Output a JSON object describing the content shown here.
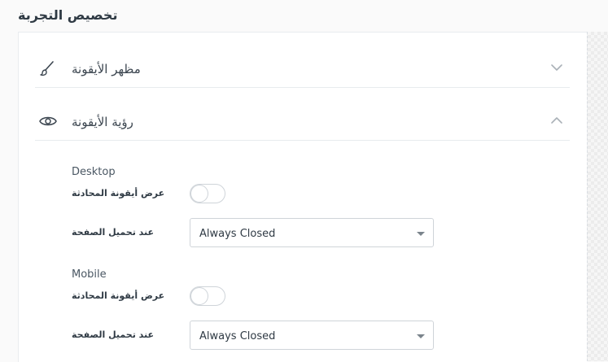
{
  "page": {
    "title": "تخصيص التجربة"
  },
  "sections": [
    {
      "label": "مظهر الأيقونة",
      "icon": "brush-icon",
      "expanded": false
    },
    {
      "label": "رؤية الأيقونة",
      "icon": "eye-icon",
      "expanded": true
    }
  ],
  "desktop": {
    "label": "Desktop",
    "show_icon_label": "عرض أيقونة المحادثة",
    "show_icon_enabled": false,
    "on_load_label": "عند تحميل الصفحة",
    "on_load_value": "Always Closed"
  },
  "mobile": {
    "label": "Mobile",
    "show_icon_label": "عرض أيقونة المحادثة",
    "show_icon_enabled": false,
    "on_load_label": "عند تحميل الصفحة",
    "on_load_value": "Always Closed"
  },
  "colors": {
    "text": "#3c4650",
    "border": "#cfd4d9",
    "divider": "#e8ebee"
  }
}
